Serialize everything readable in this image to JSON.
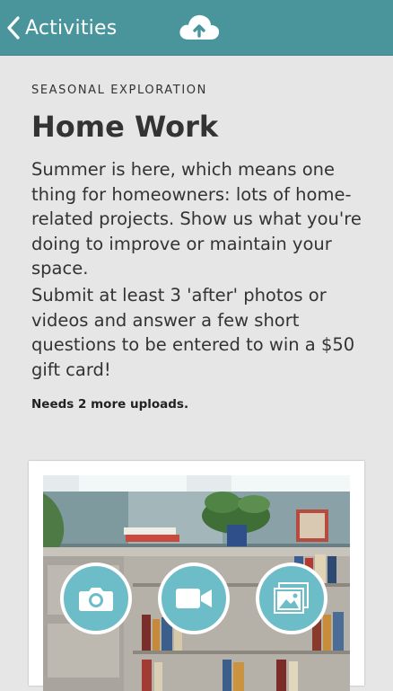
{
  "nav": {
    "back_label": "Activities",
    "back_icon": "chevron-left-icon",
    "upload_icon": "cloud-upload-icon",
    "bar_color": "#4a959c"
  },
  "activity": {
    "eyebrow": "SEASONAL EXPLORATION",
    "title": "Home Work",
    "description_1": "Summer is here, which means one thing for homeowners: lots of home-related projects. Show us what you're doing to improve or maintain your space.",
    "description_2": "Submit at least 3 'after' photos or videos and answer a few short questions to be entered to win a $50 gift card!",
    "status": "Needs 2 more uploads."
  },
  "media_card": {
    "buttons": [
      {
        "icon": "camera-icon"
      },
      {
        "icon": "video-camera-icon"
      },
      {
        "icon": "photo-gallery-icon"
      }
    ],
    "button_color": "#6dbdc9"
  }
}
